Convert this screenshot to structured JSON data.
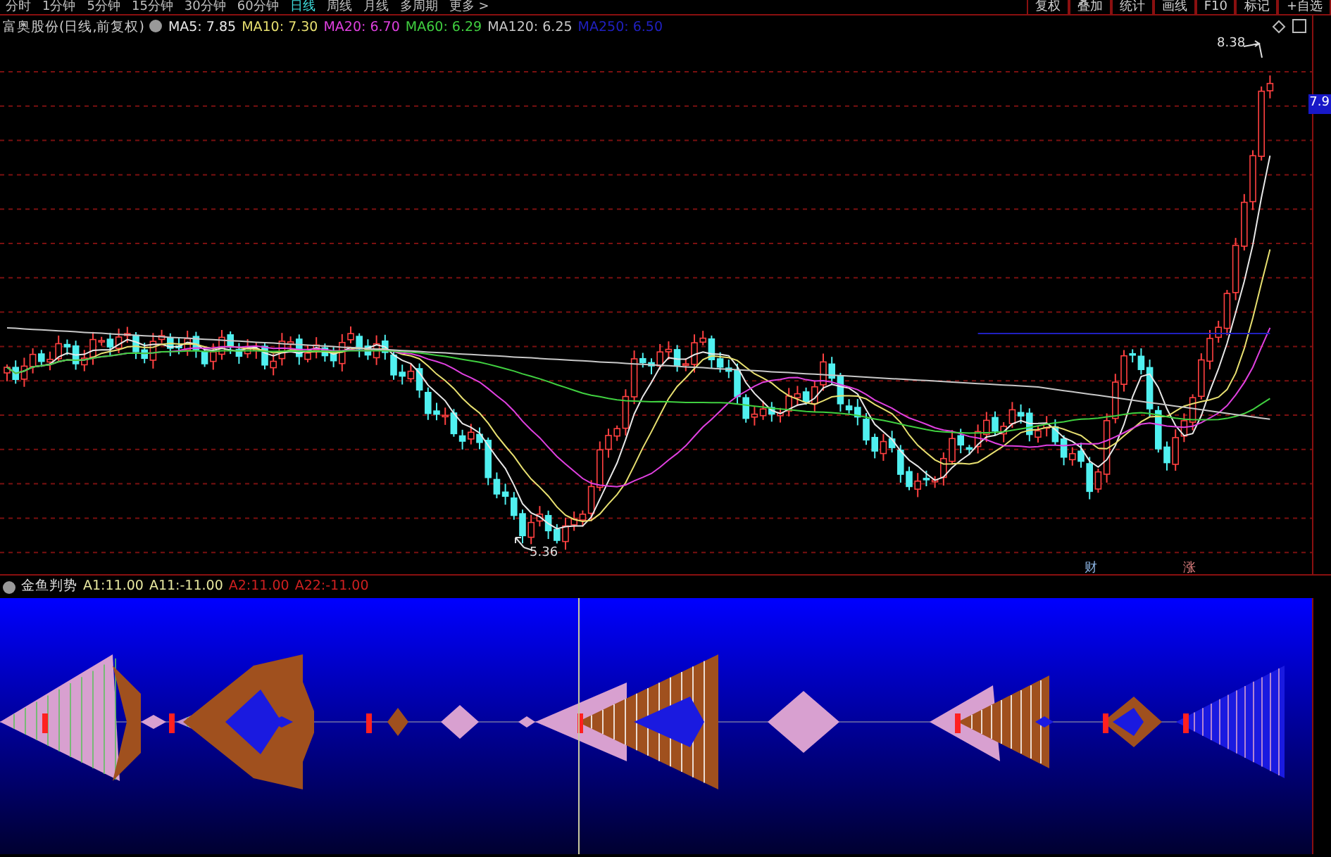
{
  "period_tabs": [
    {
      "label": "分时",
      "selected": false
    },
    {
      "label": "1分钟",
      "selected": false
    },
    {
      "label": "5分钟",
      "selected": false
    },
    {
      "label": "15分钟",
      "selected": false
    },
    {
      "label": "30分钟",
      "selected": false
    },
    {
      "label": "60分钟",
      "selected": false
    },
    {
      "label": "日线",
      "selected": true
    },
    {
      "label": "周线",
      "selected": false
    },
    {
      "label": "月线",
      "selected": false
    },
    {
      "label": "多周期",
      "selected": false
    },
    {
      "label": "更多 >",
      "selected": false
    }
  ],
  "toolbar_buttons": [
    "复权",
    "叠加",
    "统计",
    "画线",
    "F10",
    "标记",
    "+自选"
  ],
  "chart": {
    "title": "富奥股份(日线,前复权)",
    "indicators": [
      {
        "label": "MA5: 7.85",
        "color": "#e8e8e8"
      },
      {
        "label": "MA10: 7.30",
        "color": "#e8e070"
      },
      {
        "label": "MA20: 6.70",
        "color": "#e040e0"
      },
      {
        "label": "MA60: 6.29",
        "color": "#40d040"
      },
      {
        "label": "MA120: 6.25",
        "color": "#c8c8c8"
      },
      {
        "label": "MA250: 6.50",
        "color": "#2020c0"
      }
    ],
    "high_label": "8.38",
    "low_label": "5.36",
    "price_marker": "7.9",
    "event_marks": [
      {
        "text": "财",
        "color": "#8fb8e8"
      },
      {
        "text": "涨",
        "color": "#e08080"
      }
    ]
  },
  "sub_chart": {
    "title": "金鱼判势",
    "values": [
      {
        "label": "A1:11.00",
        "color": "#e8e8a0"
      },
      {
        "label": "A11:-11.00",
        "color": "#e8e8a0"
      },
      {
        "label": "A2:11.00",
        "color": "#d02020"
      },
      {
        "label": "A22:-11.00",
        "color": "#d02020"
      }
    ]
  }
}
